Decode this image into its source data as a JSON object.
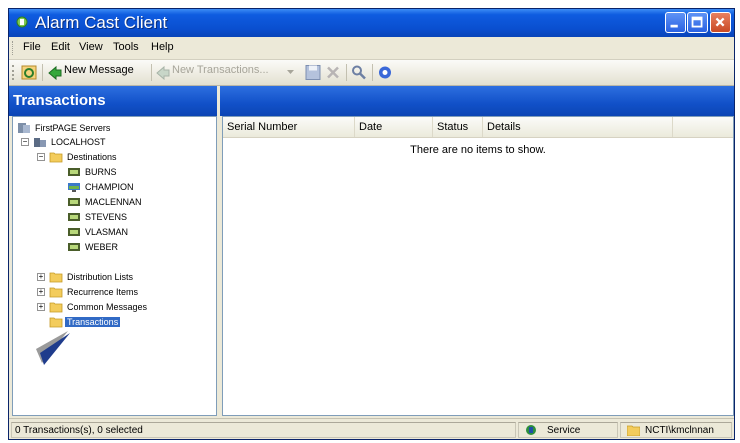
{
  "window": {
    "title": "Alarm Cast Client"
  },
  "menu": [
    "File",
    "Edit",
    "View",
    "Tools",
    "Help"
  ],
  "toolbar": {
    "new_message": "New Message",
    "new_transactions": "New Transactions..."
  },
  "pane": {
    "title": "Transactions"
  },
  "tree": {
    "root": "FirstPAGE Servers",
    "host": "LOCALHOST",
    "destinations": "Destinations",
    "dest_items": [
      "BURNS",
      "CHAMPION",
      "MACLENNAN",
      "STEVENS",
      "VLASMAN",
      "WEBER"
    ],
    "distribution": "Distribution Lists",
    "recurrence": "Recurrence Items",
    "common": "Common Messages",
    "transactions": "Transactions"
  },
  "list": {
    "columns": [
      "Serial Number",
      "Date",
      "Status",
      "Details"
    ],
    "empty_text": "There are no items to show."
  },
  "status": {
    "summary": "0 Transactions(s), 0 selected",
    "service": "Service",
    "user": "NCTI\\kmclnnan"
  },
  "colors": {
    "titlebar": "#0a4fd0",
    "accent": "#316ac5",
    "chrome": "#ece9d8"
  }
}
